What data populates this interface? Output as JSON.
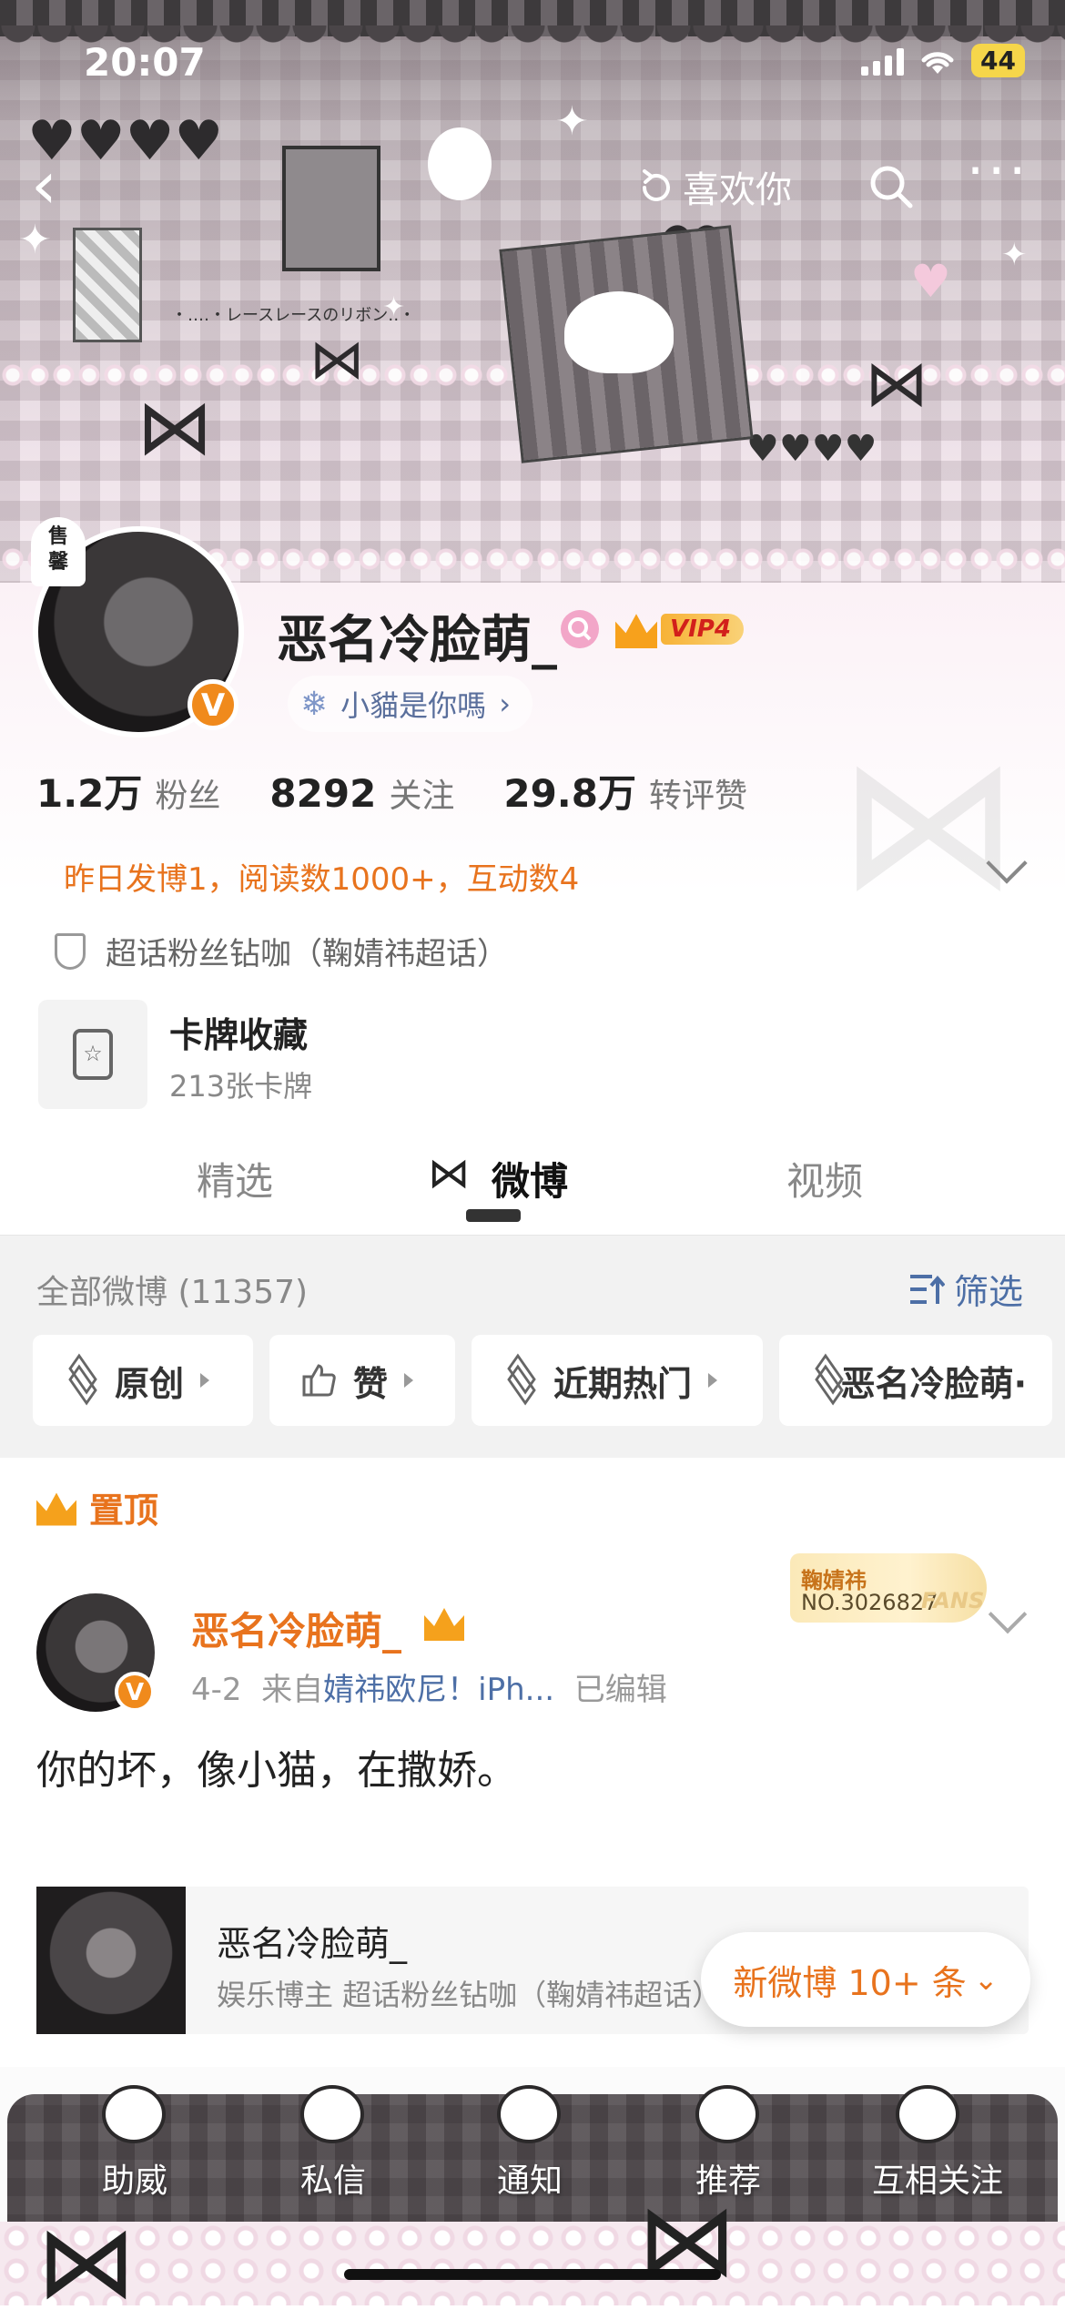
{
  "status_bar": {
    "time": "20:07",
    "battery": "44"
  },
  "header": {
    "like_you": "喜欢你"
  },
  "banner_text": "・‥‥・レースレースのリボン‥・",
  "profile": {
    "sale_tag": "售\n馨",
    "name": "恶名冷脸萌_",
    "vip_label": "VIP4",
    "title_chip": "小貓是你嗎",
    "verified_badge": "V",
    "stats": [
      {
        "num": "1.2万",
        "label": "粉丝"
      },
      {
        "num": "8292",
        "label": "关注"
      },
      {
        "num": "29.8万",
        "label": "转评赞"
      }
    ],
    "summary": "昨日发博1，阅读数1000+，互动数4",
    "group": "超话粉丝钻咖（鞠婧祎超话）",
    "card": {
      "title": "卡牌收藏",
      "sub": "213张卡牌"
    }
  },
  "tabs": [
    {
      "label": "精选",
      "active": false
    },
    {
      "label": "微博",
      "active": true
    },
    {
      "label": "视频",
      "active": false
    }
  ],
  "posts_header": {
    "all": "全部微博 (11357)",
    "filter": "筛选"
  },
  "chips": [
    {
      "label": "原创",
      "icon": "layers-icon"
    },
    {
      "label": "赞",
      "icon": "thumbs-up-icon"
    },
    {
      "label": "近期热门",
      "icon": "layers-icon"
    },
    {
      "label": "恶名冷脸萌·",
      "icon": "layers-icon"
    }
  ],
  "pinned": {
    "label": "置顶",
    "author": "恶名冷脸萌_",
    "date": "4-2",
    "from_prefix": "来自",
    "source": "婧祎欧尼！iPh...",
    "edited": "已编辑",
    "fans_name": "鞠婧祎",
    "fans_no": "NO.3026827",
    "fans_tag": "FANS",
    "text": "你的坏，像小猫，在撒娇。",
    "repost": {
      "name": "恶名冷脸萌_",
      "sub": "娱乐博主 超话粉丝钻咖（鞠婧祎超话）"
    }
  },
  "new_posts": "新微博 10+ 条",
  "bottom_tabs": [
    {
      "label": "助威"
    },
    {
      "label": "私信"
    },
    {
      "label": "通知"
    },
    {
      "label": "推荐"
    },
    {
      "label": "互相关注"
    }
  ],
  "colors": {
    "accent": "#e8731d",
    "link": "#4d6fa6",
    "vip_gold": "#f7a11c"
  }
}
